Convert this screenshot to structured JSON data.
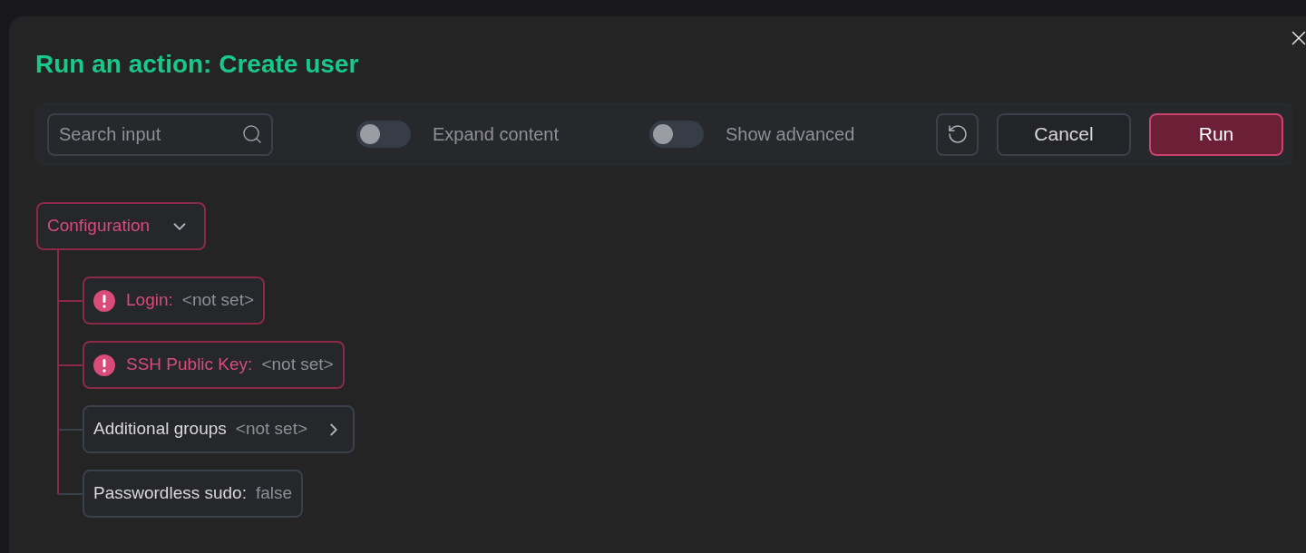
{
  "dialog": {
    "title": "Run an action: Create user"
  },
  "toolbar": {
    "search": {
      "placeholder": "Search input"
    },
    "toggles": [
      {
        "label": "Expand content",
        "on": false
      },
      {
        "label": "Show advanced",
        "on": false
      }
    ],
    "buttons": [
      {
        "label": "Cancel",
        "kind": "secondary"
      },
      {
        "label": "Run",
        "kind": "primary"
      }
    ]
  },
  "tree": {
    "label": "Configuration",
    "error": true,
    "expanded": true,
    "children": [
      {
        "label": "Login:",
        "value": "<not set>",
        "error": true,
        "expandable": false
      },
      {
        "label": "SSH Public Key:",
        "value": "<not set>",
        "error": true,
        "expandable": false
      },
      {
        "label": "Additional groups",
        "value": "<not set>",
        "error": false,
        "expandable": true
      },
      {
        "label": "Passwordless sudo:",
        "value": "false",
        "error": false,
        "expandable": false
      }
    ]
  }
}
